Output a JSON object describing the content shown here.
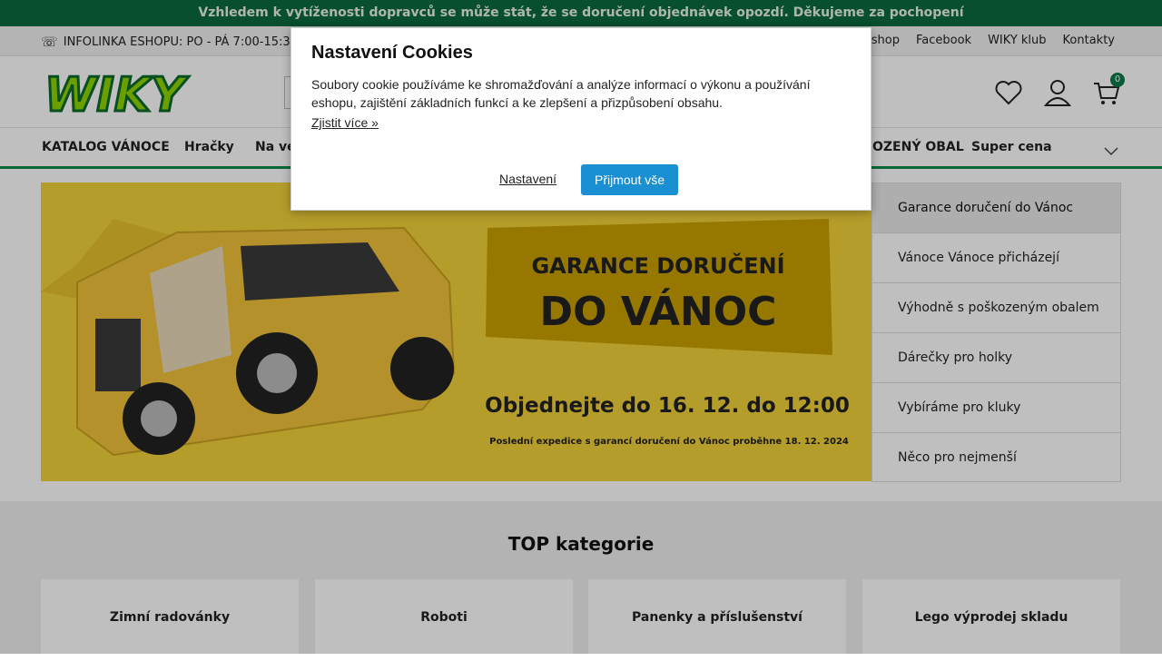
{
  "announcement": "Vzhledem k vytíženosti dopravců se může stát, že se doručení objednávek opozdí. Děkujeme za pochopení",
  "topbar": {
    "hotline": "INFOLINKA ESHOPU: PO - PÁ 7:00-15:30 (m",
    "links": [
      "B eshop",
      "Facebook",
      "WIKY klub",
      "Kontakty"
    ]
  },
  "header": {
    "logo_text": "WIKY",
    "cart_count": "0"
  },
  "nav": {
    "items": [
      "KATALOG VÁNOCE",
      "Hračky",
      "Na ve",
      "OZENÝ OBAL",
      "Super cena"
    ]
  },
  "banner": {
    "title_line1": "GARANCE DORUČENÍ",
    "title_line2": "DO VÁNOC",
    "order_by": "Objednejte do 16. 12. do 12:00",
    "note": "Poslední expedice s garancí doručení do Vánoc proběhne 18. 12. 2024"
  },
  "sidelist": [
    "Garance doručení do Vánoc",
    "Vánoce Vánoce přicházejí",
    "Výhodně s poškozeným obalem",
    "Dárečky pro holky",
    "Vybíráme pro kluky",
    "Něco pro nejmenší"
  ],
  "top_categories": {
    "heading": "TOP kategorie",
    "items": [
      "Zimní radovánky",
      "Roboti",
      "Panenky a příslušenství",
      "Lego výprodej skladu"
    ]
  },
  "cookie_modal": {
    "title": "Nastavení Cookies",
    "text": "Soubory cookie používáme ke shromažďování a analýze informací o výkonu a používání eshopu, zajištění základních funkcí a ke zlepšení a přizpůsobení obsahu.",
    "more_link": "Zjistit více »",
    "settings_label": "Nastavení",
    "accept_label": "Přijmout vše"
  },
  "colors": {
    "brand_green": "#0b7a4a",
    "banner_yellow": "#f2d23a",
    "accept_blue": "#1a8fd1"
  }
}
